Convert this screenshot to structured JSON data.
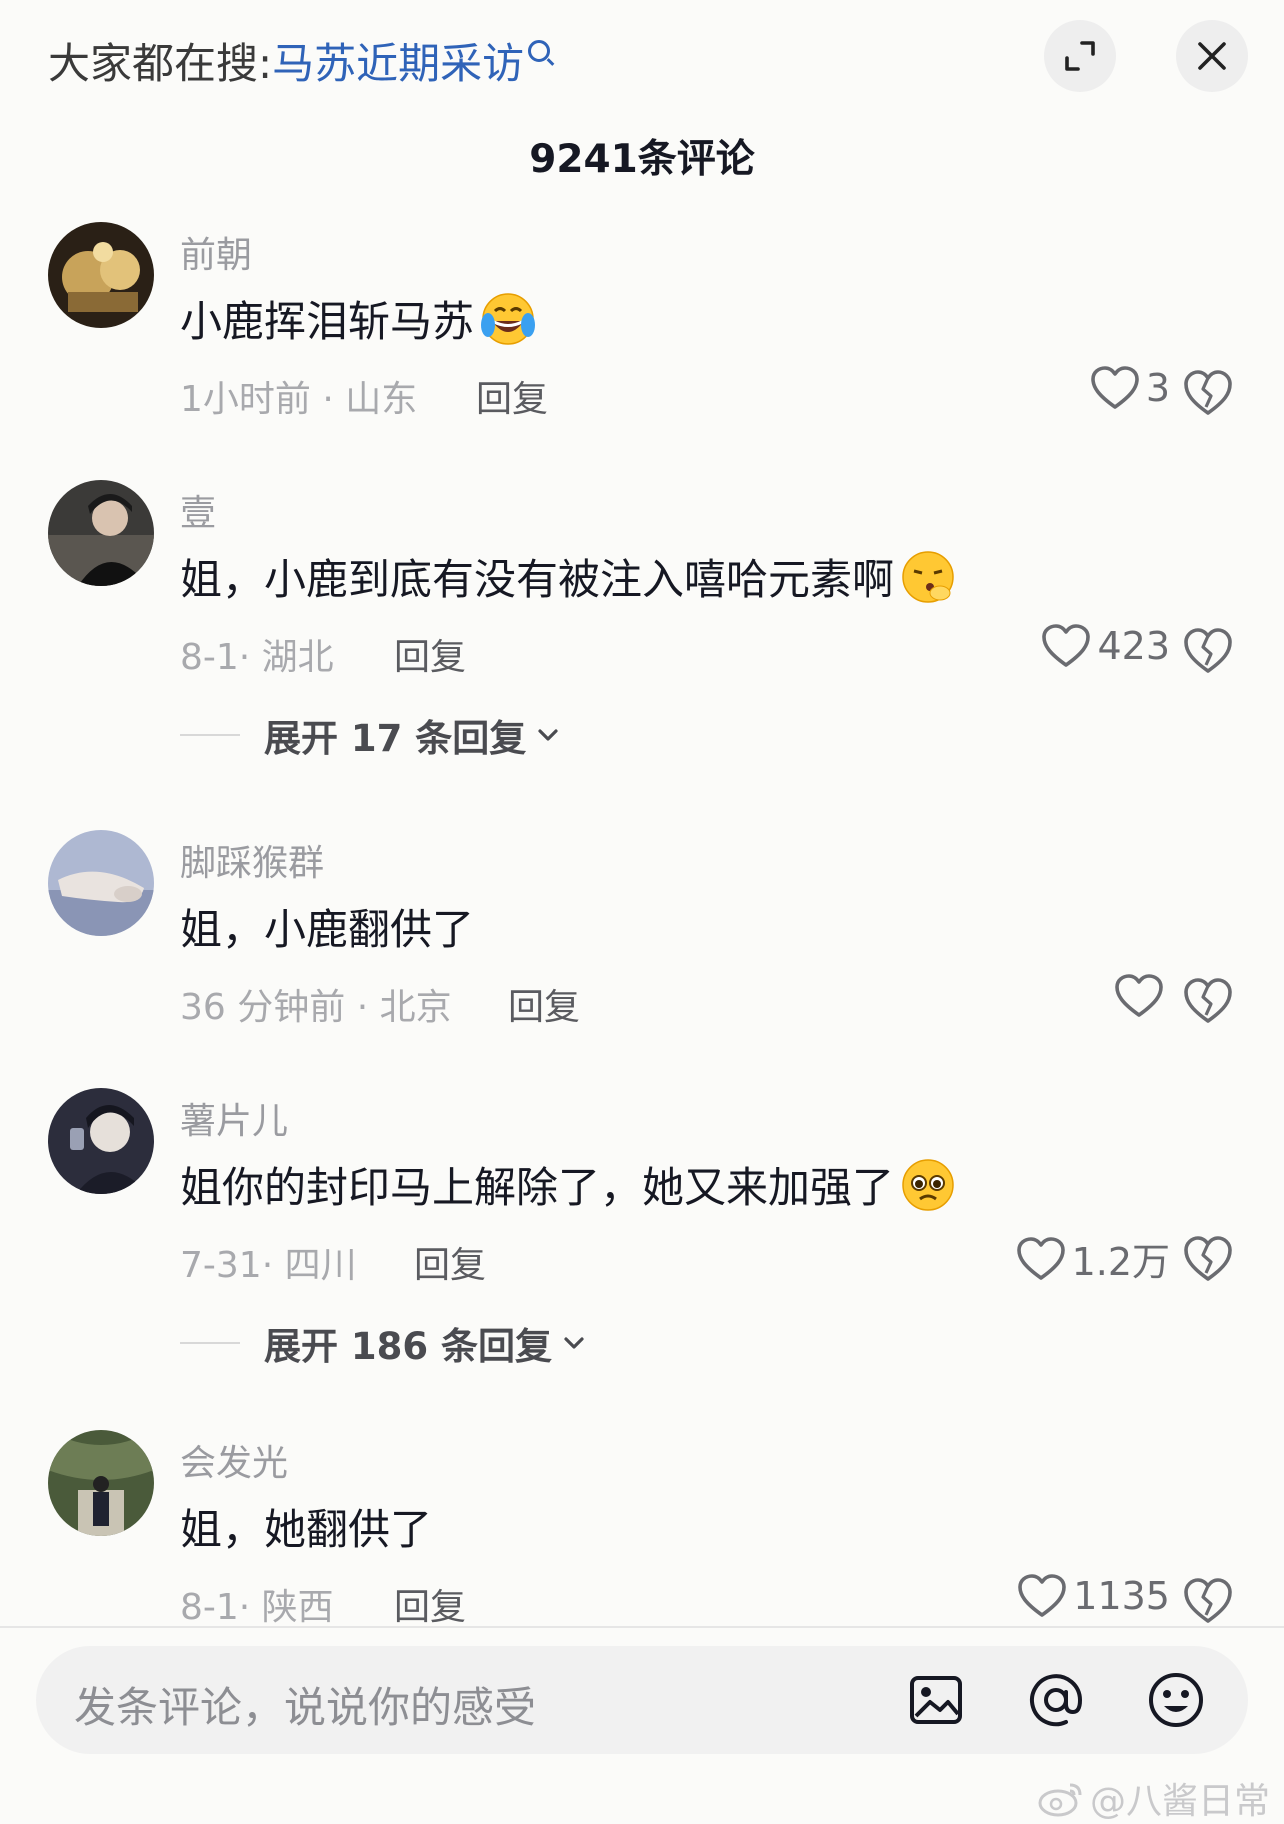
{
  "header": {
    "search_prefix": "大家都在搜:",
    "search_keyword": "马苏近期采访",
    "comment_count_title": "9241条评论"
  },
  "comments": [
    {
      "username": "前朝",
      "text": "小鹿挥泪斩马苏",
      "emoji": "crying-laughing-emoji",
      "meta": "1小时前 · 山东",
      "reply_label": "回复",
      "likes": "3"
    },
    {
      "username": "壹",
      "text": "姐，小鹿到底有没有被注入嘻哈元素啊",
      "emoji": "whistling-emoji",
      "meta": "8-1· 湖北",
      "reply_label": "回复",
      "likes": "423",
      "expand_label": "展开 17 条回复"
    },
    {
      "username": "脚踩猴群",
      "text": "姐，小鹿翻供了",
      "meta": "36 分钟前 · 北京",
      "reply_label": "回复",
      "likes": ""
    },
    {
      "username": "薯片儿",
      "text": "姐你的封印马上解除了，她又来加强了",
      "emoji": "pleading-emoji",
      "meta": "7-31· 四川",
      "reply_label": "回复",
      "likes": "1.2万",
      "expand_label": "展开 186 条回复"
    },
    {
      "username": "会发光",
      "text": "姐，她翻供了",
      "meta": "8-1· 陕西",
      "reply_label": "回复",
      "likes": "1135"
    }
  ],
  "input_bar": {
    "placeholder": "发条评论，说说你的感受",
    "icons": [
      "image-icon",
      "at-icon",
      "emoji-icon"
    ]
  },
  "watermark": "@八酱日常",
  "colors": {
    "keyword": "#2f63b8",
    "background": "#fbfbf9",
    "text": "#161823",
    "muted": "#a8a9ad"
  }
}
